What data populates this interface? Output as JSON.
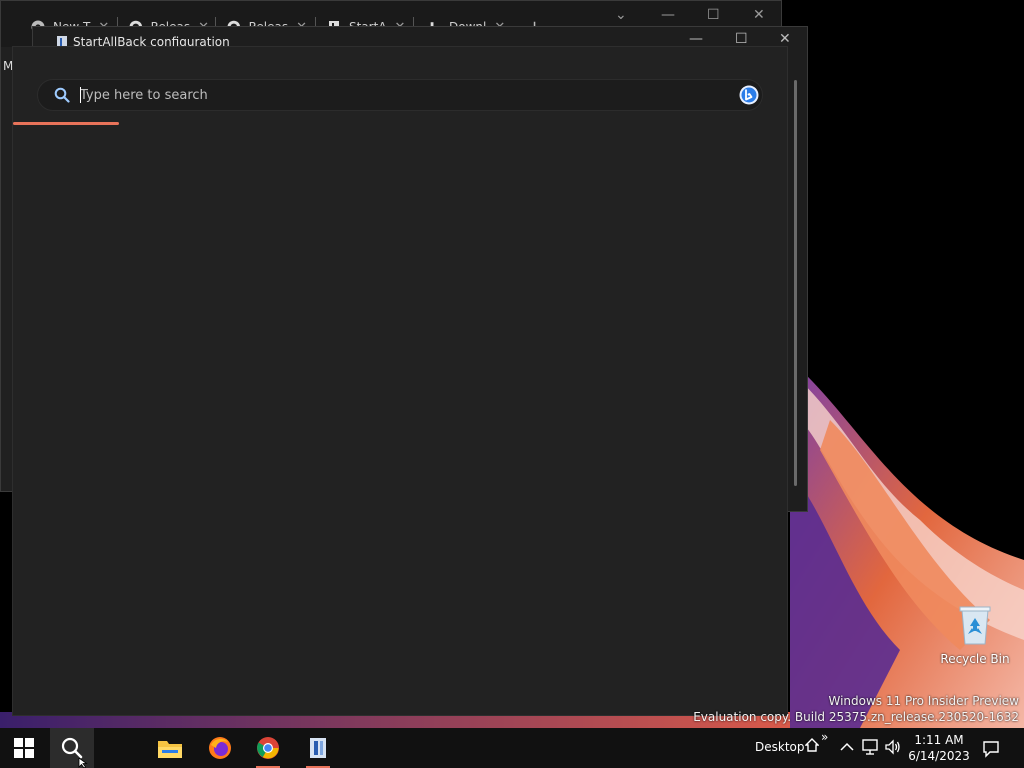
{
  "browser": {
    "tabs": [
      {
        "label": "New T",
        "icon": "chrome-icon"
      },
      {
        "label": "Releas",
        "icon": "github-icon"
      },
      {
        "label": "Releas",
        "icon": "github-icon"
      },
      {
        "label": "StartA",
        "icon": "startallback-icon"
      },
      {
        "label": "Downl",
        "icon": "download-icon"
      }
    ],
    "side_letter": "M"
  },
  "sab_window": {
    "title": "StartAllBack configuration"
  },
  "search": {
    "placeholder": "Type here to search"
  },
  "desktop": {
    "recycle_bin_label": "Recycle Bin",
    "watermark_line1": "Windows 11 Pro Insider Preview",
    "watermark_line2": "Evaluation copy. Build 25375.zn_release.230520-1632"
  },
  "taskbar": {
    "pinned": [
      "windows-start-icon",
      "search-icon",
      "file-explorer-icon",
      "firefox-icon",
      "chrome-icon",
      "startallback-icon"
    ],
    "desktop_label": "Desktop",
    "chevron": "»",
    "time": "1:11 AM",
    "date": "6/14/2023"
  },
  "colors": {
    "accent": "#e8735a",
    "panel_bg": "#222222",
    "taskbar_bg": "#111111"
  }
}
